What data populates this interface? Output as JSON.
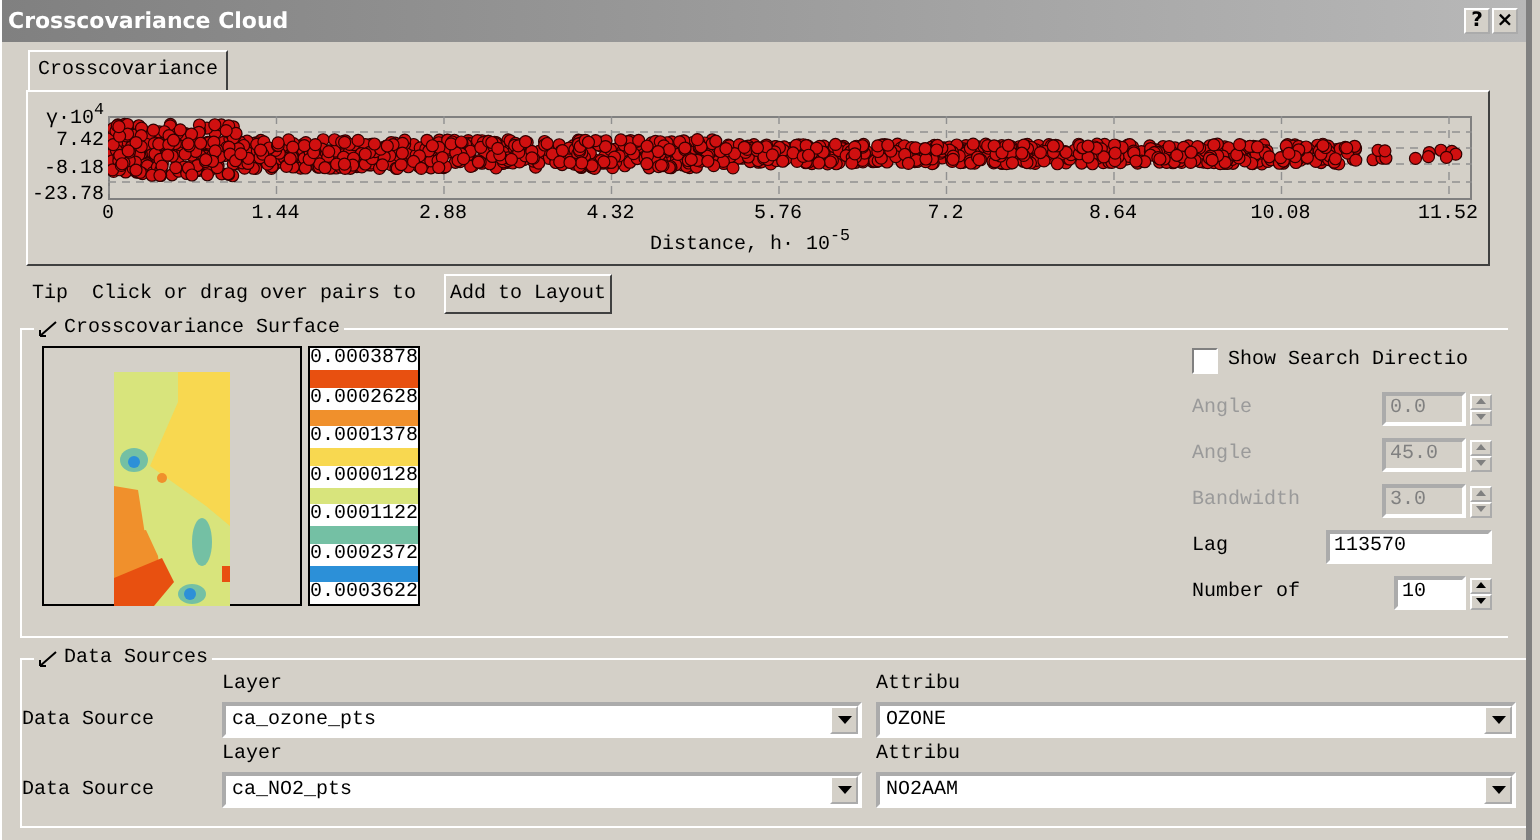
{
  "window": {
    "title": "Crosscovariance Cloud",
    "buttons": [
      "?",
      "×"
    ]
  },
  "tabs": [
    {
      "label": "Crosscovariance",
      "selected": true
    }
  ],
  "cloud": {
    "y_axis_label": "γ·10$^{4}$",
    "y_ticks": [
      "7.42",
      "-8.18",
      "-23.78"
    ],
    "x_ticks": [
      "0",
      "1.44",
      "2.88",
      "4.32",
      "5.76",
      "7.2",
      "8.64",
      "10.08",
      "11.52"
    ],
    "x_axis_label": "Distance, h· 10$^{-5}$"
  },
  "tip": {
    "label": "Tip",
    "text": "Click or drag over pairs to",
    "button": "Add to Layout"
  },
  "surface": {
    "title": "Crosscovariance Surface",
    "expanded": true,
    "legend_labels": [
      "0.0003878",
      "0.0002628",
      "0.0001378",
      "0.0000128",
      "0.0001122",
      "0.0002372",
      "0.0003622"
    ],
    "legend_bands": [
      {
        "color": "#e85010"
      },
      {
        "color": "#f0902c"
      },
      {
        "color": "#f8d850"
      },
      {
        "color": "#d8e47c"
      },
      {
        "color": "#74c0a4"
      },
      {
        "color": "#2c90d8"
      }
    ]
  },
  "show_search_direction": {
    "label": "Show Search Directio",
    "checked": false
  },
  "params": [
    {
      "kind": "spinner",
      "label": "Angle",
      "value": "0.0",
      "disabled": true
    },
    {
      "kind": "spinner",
      "label": "Angle",
      "value": "45.0",
      "disabled": true
    },
    {
      "kind": "spinner",
      "label": "Bandwidth",
      "value": "3.0",
      "disabled": true
    },
    {
      "kind": "text",
      "label": "Lag",
      "value": "113570",
      "disabled": false
    },
    {
      "kind": "spinner",
      "label": "Number of",
      "value": "10",
      "disabled": false
    }
  ],
  "data_sources": {
    "title": "Data Sources",
    "expanded": true,
    "rows": [
      {
        "label": "Data Source",
        "layer_label": "Layer",
        "layer": "ca_ozone_pts",
        "attribute_label": "Attribu",
        "attribute": "OZONE"
      },
      {
        "label": "Data Source",
        "layer_label": "Layer",
        "layer": "ca_NO2_pts",
        "attribute_label": "Attribu",
        "attribute": "NO2AAM"
      }
    ]
  }
}
